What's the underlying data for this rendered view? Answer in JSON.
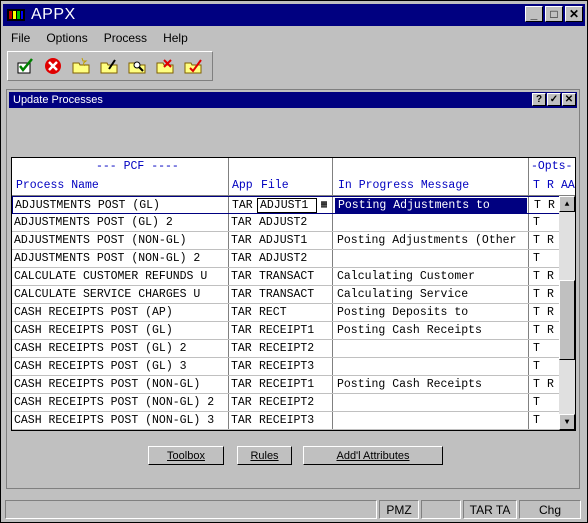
{
  "app": {
    "title": "APPX"
  },
  "title_buttons": {
    "minimize": "_",
    "maximize": "□",
    "close": "✕"
  },
  "menu": [
    "File",
    "Options",
    "Process",
    "Help"
  ],
  "mdi": {
    "title": "Update Processes",
    "help": "?",
    "ok": "✓",
    "close": "✕"
  },
  "grid": {
    "headers": {
      "process_name": "Process Name",
      "pcf": "--- PCF ----",
      "app": "App",
      "file": "File",
      "msg": "In Progress Message",
      "opts": "-Opts-",
      "t": "T",
      "r": "R",
      "aa": "AA"
    },
    "rows": [
      {
        "name": "ADJUSTMENTS POST (GL)",
        "app": "TAR",
        "file": "ADJUST1",
        "msg": "Posting Adjustments to",
        "t": "T",
        "r": "R"
      },
      {
        "name": "ADJUSTMENTS POST (GL) 2",
        "app": "TAR",
        "file": "ADJUST2",
        "msg": "",
        "t": "T",
        "r": ""
      },
      {
        "name": "ADJUSTMENTS POST (NON-GL)",
        "app": "TAR",
        "file": "ADJUST1",
        "msg": "Posting Adjustments (Other",
        "t": "T",
        "r": "R"
      },
      {
        "name": "ADJUSTMENTS POST (NON-GL) 2",
        "app": "TAR",
        "file": "ADJUST2",
        "msg": "",
        "t": "T",
        "r": ""
      },
      {
        "name": "CALCULATE CUSTOMER REFUNDS U",
        "app": "TAR",
        "file": "TRANSACT",
        "msg": "Calculating Customer",
        "t": "T",
        "r": "R"
      },
      {
        "name": "CALCULATE SERVICE CHARGES U",
        "app": "TAR",
        "file": "TRANSACT",
        "msg": "Calculating Service",
        "t": "T",
        "r": "R"
      },
      {
        "name": "CASH RECEIPTS POST (AP)",
        "app": "TAR",
        "file": "RECT",
        "msg": "Posting Deposits to",
        "t": "T",
        "r": "R"
      },
      {
        "name": "CASH RECEIPTS POST (GL)",
        "app": "TAR",
        "file": "RECEIPT1",
        "msg": "Posting Cash Receipts",
        "t": "T",
        "r": "R"
      },
      {
        "name": "CASH RECEIPTS POST (GL) 2",
        "app": "TAR",
        "file": "RECEIPT2",
        "msg": "",
        "t": "T",
        "r": ""
      },
      {
        "name": "CASH RECEIPTS POST (GL) 3",
        "app": "TAR",
        "file": "RECEIPT3",
        "msg": "",
        "t": "T",
        "r": ""
      },
      {
        "name": "CASH RECEIPTS POST (NON-GL)",
        "app": "TAR",
        "file": "RECEIPT1",
        "msg": "Posting Cash Receipts",
        "t": "T",
        "r": "R"
      },
      {
        "name": "CASH RECEIPTS POST (NON-GL) 2",
        "app": "TAR",
        "file": "RECEIPT2",
        "msg": "",
        "t": "T",
        "r": ""
      },
      {
        "name": "CASH RECEIPTS POST (NON-GL) 3",
        "app": "TAR",
        "file": "RECEIPT3",
        "msg": "",
        "t": "T",
        "r": ""
      }
    ]
  },
  "buttons": {
    "toolbox": "Toolbox",
    "rules": "Rules",
    "attributes": "Add'l Attributes"
  },
  "status": {
    "p1": "",
    "p2": "PMZ",
    "p3": "",
    "p4": "TAR TA",
    "p5": "Chg"
  },
  "colors": {
    "title_bg": "#000080",
    "header_text": "#0000c0",
    "face": "#c0c0c0"
  }
}
